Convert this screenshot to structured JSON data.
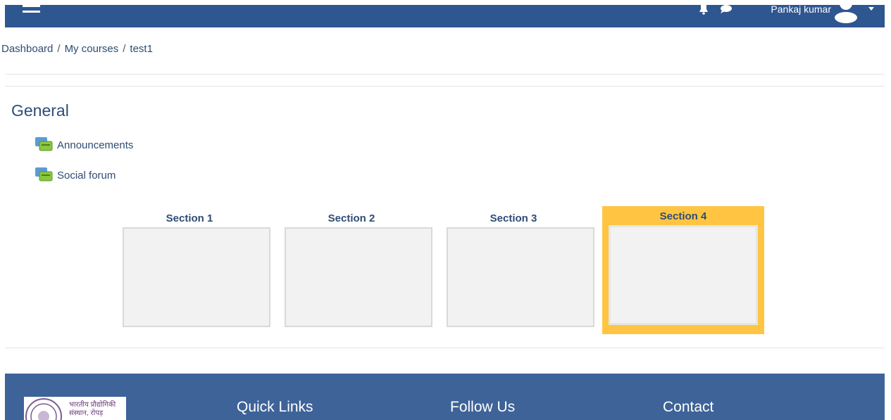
{
  "navbar": {
    "menu_icon": "hamburger-icon",
    "notifications_icon": "bell-icon",
    "messages_icon": "chat-bubble-icon",
    "user_name": "Pankaj kumar",
    "avatar_icon": "user-avatar-icon",
    "dropdown_icon": "caret-down-icon",
    "color": "#2e5690"
  },
  "breadcrumb": {
    "items": [
      "Dashboard",
      "My courses",
      "test1"
    ],
    "separator": "/"
  },
  "general": {
    "title": "General",
    "activities": [
      {
        "label": "Announcements",
        "icon": "forum-icon"
      },
      {
        "label": "Social forum",
        "icon": "forum-icon"
      }
    ]
  },
  "sections": [
    {
      "title": "Section 1",
      "active": false
    },
    {
      "title": "Section 2",
      "active": false
    },
    {
      "title": "Section 3",
      "active": false
    },
    {
      "title": "Section 4",
      "active": true
    }
  ],
  "footer": {
    "logo_text_line1": "भारतीय प्रौद्योगिकी",
    "logo_text_line2": "संस्थान, रोपड़",
    "headings": [
      "Quick Links",
      "Follow Us",
      "Contact"
    ],
    "color": "#3e6398"
  },
  "colors": {
    "accent_active": "#ffc542",
    "link": "#2e4c74"
  }
}
